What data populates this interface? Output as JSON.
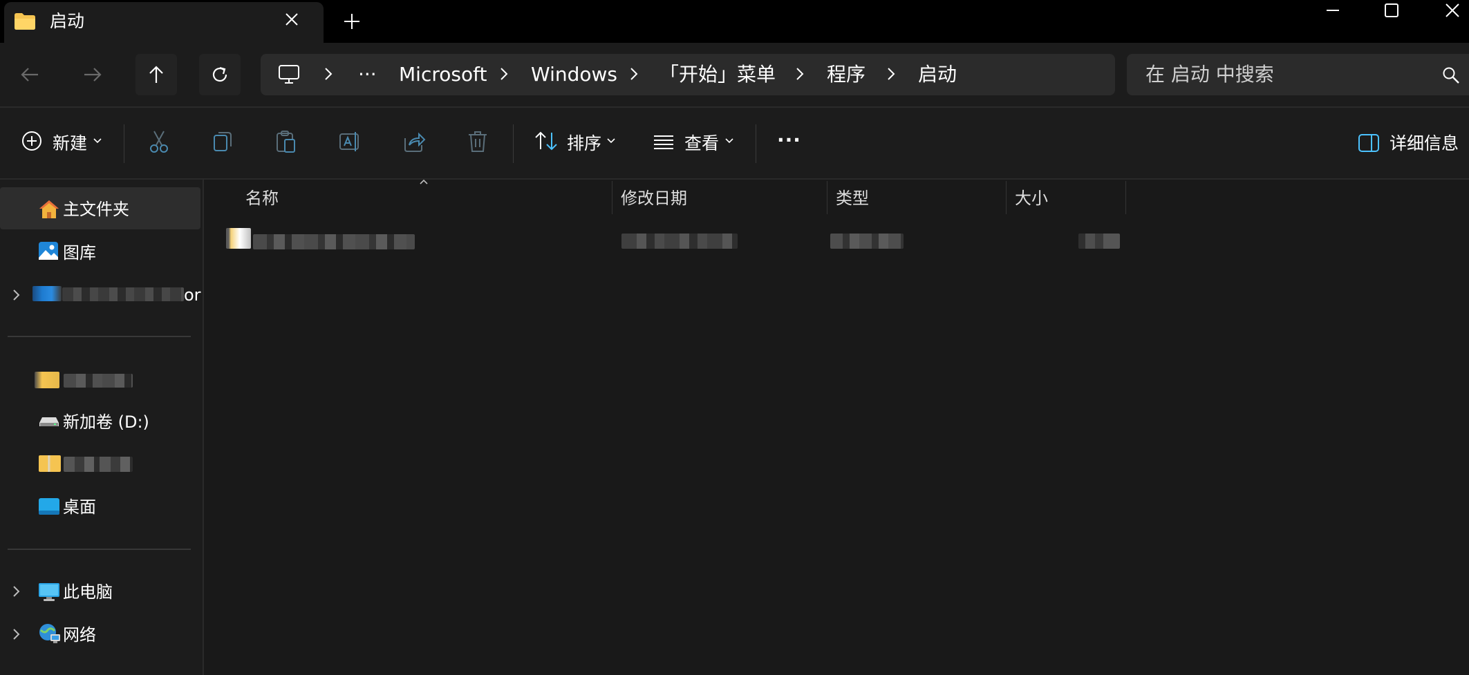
{
  "tab": {
    "title": "启动"
  },
  "breadcrumb": {
    "overflow": "···",
    "items": [
      "Microsoft",
      "Windows",
      "「开始」菜单",
      "程序",
      "启动"
    ]
  },
  "search": {
    "placeholder": "在 启动 中搜索"
  },
  "commandbar": {
    "new_label": "新建",
    "sort_label": "排序",
    "view_label": "查看",
    "more_label": "···",
    "details_label": "详细信息"
  },
  "sidebar": {
    "home": "主文件夹",
    "gallery": "图库",
    "onedrive_suffix": "or",
    "drive_d": "新加卷 (D:)",
    "desktop": "桌面",
    "this_pc": "此电脑",
    "network": "网络"
  },
  "columns": {
    "name": "名称",
    "date": "修改日期",
    "type": "类型",
    "size": "大小"
  },
  "colors": {
    "background": "#191919",
    "accent": "#4cc2ff",
    "folder": "#f5c451"
  },
  "icons": [
    "folder-icon",
    "close-icon",
    "plus-icon",
    "minimize-icon",
    "maximize-icon",
    "back-icon",
    "forward-icon",
    "up-icon",
    "refresh-icon",
    "computer-icon",
    "chevron-right-icon",
    "search-icon",
    "add-circle-icon",
    "cut-icon",
    "copy-icon",
    "paste-icon",
    "rename-icon",
    "share-icon",
    "delete-icon",
    "sort-icon",
    "view-list-icon",
    "more-icon",
    "details-pane-icon",
    "home-icon",
    "gallery-icon",
    "drive-icon",
    "desktop-icon",
    "network-icon"
  ]
}
